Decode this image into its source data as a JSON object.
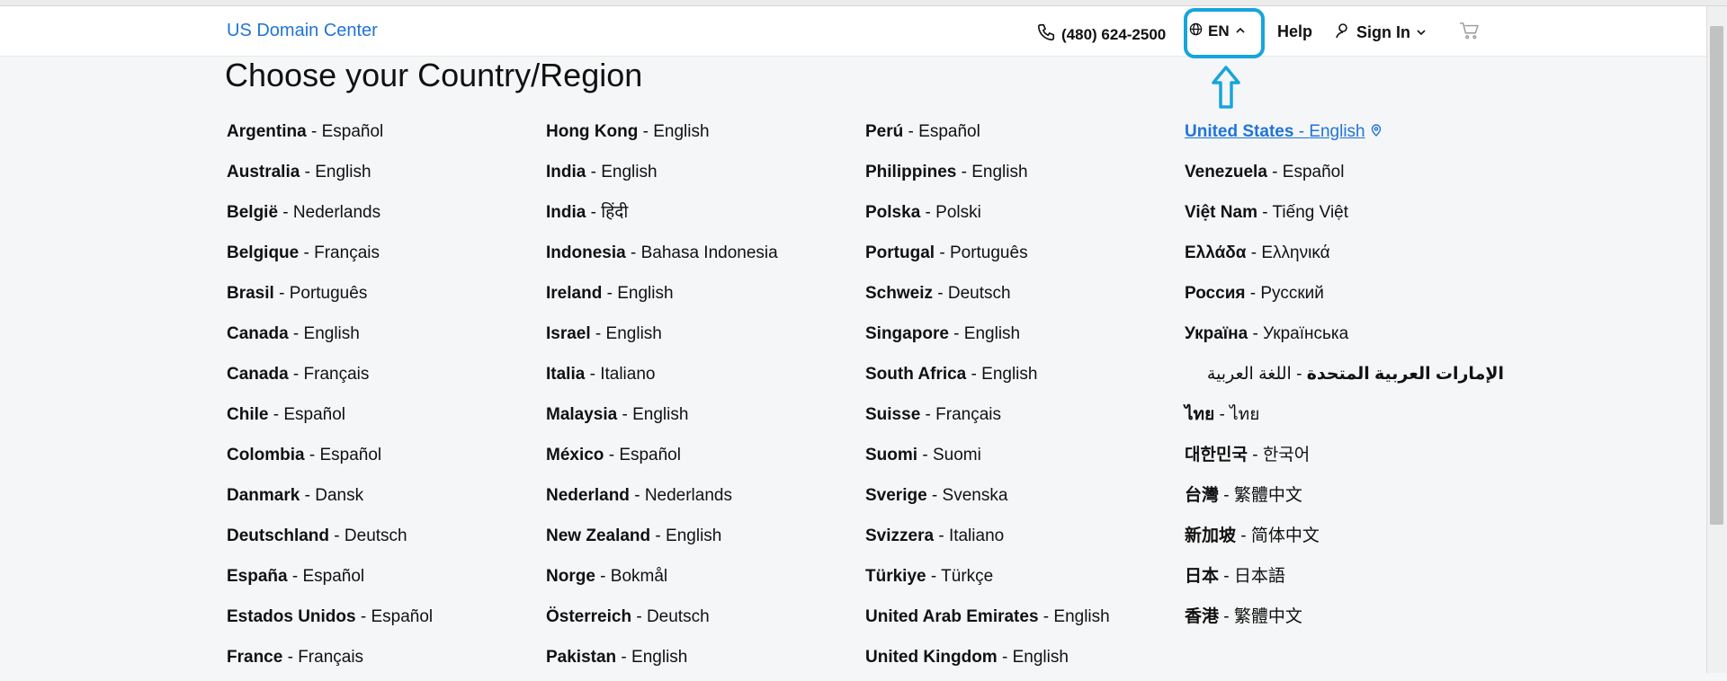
{
  "header": {
    "brand": "US Domain Center",
    "phone": "(480) 624-2500",
    "lang": "EN",
    "help": "Help",
    "signin": "Sign In"
  },
  "page": {
    "title": "Choose your Country/Region"
  },
  "countries": [
    {
      "name": "Argentina",
      "lang": "Español"
    },
    {
      "name": "Australia",
      "lang": "English"
    },
    {
      "name": "België",
      "lang": "Nederlands"
    },
    {
      "name": "Belgique",
      "lang": "Français"
    },
    {
      "name": "Brasil",
      "lang": "Português"
    },
    {
      "name": "Canada",
      "lang": "English"
    },
    {
      "name": "Canada",
      "lang": "Français"
    },
    {
      "name": "Chile",
      "lang": "Español"
    },
    {
      "name": "Colombia",
      "lang": "Español"
    },
    {
      "name": "Danmark",
      "lang": "Dansk"
    },
    {
      "name": "Deutschland",
      "lang": "Deutsch"
    },
    {
      "name": "España",
      "lang": "Español"
    },
    {
      "name": "Estados Unidos",
      "lang": "Español"
    },
    {
      "name": "France",
      "lang": "Français"
    },
    {
      "name": "Hong Kong",
      "lang": "English"
    },
    {
      "name": "India",
      "lang": "English"
    },
    {
      "name": "India",
      "lang": "हिंदी"
    },
    {
      "name": "Indonesia",
      "lang": "Bahasa Indonesia"
    },
    {
      "name": "Ireland",
      "lang": "English"
    },
    {
      "name": "Israel",
      "lang": "English"
    },
    {
      "name": "Italia",
      "lang": "Italiano"
    },
    {
      "name": "Malaysia",
      "lang": "English"
    },
    {
      "name": "México",
      "lang": "Español"
    },
    {
      "name": "Nederland",
      "lang": "Nederlands"
    },
    {
      "name": "New Zealand",
      "lang": "English"
    },
    {
      "name": "Norge",
      "lang": "Bokmål"
    },
    {
      "name": "Österreich",
      "lang": "Deutsch"
    },
    {
      "name": "Pakistan",
      "lang": "English"
    },
    {
      "name": "Perú",
      "lang": "Español"
    },
    {
      "name": "Philippines",
      "lang": "English"
    },
    {
      "name": "Polska",
      "lang": "Polski"
    },
    {
      "name": "Portugal",
      "lang": "Português"
    },
    {
      "name": "Schweiz",
      "lang": "Deutsch"
    },
    {
      "name": "Singapore",
      "lang": "English"
    },
    {
      "name": "South Africa",
      "lang": "English"
    },
    {
      "name": "Suisse",
      "lang": "Français"
    },
    {
      "name": "Suomi",
      "lang": "Suomi"
    },
    {
      "name": "Sverige",
      "lang": "Svenska"
    },
    {
      "name": "Svizzera",
      "lang": "Italiano"
    },
    {
      "name": "Türkiye",
      "lang": "Türkçe"
    },
    {
      "name": "United Arab Emirates",
      "lang": "English"
    },
    {
      "name": "United Kingdom",
      "lang": "English"
    },
    {
      "name": "United States",
      "lang": "English",
      "selected": true
    },
    {
      "name": "Venezuela",
      "lang": "Español"
    },
    {
      "name": "Việt Nam",
      "lang": "Tiếng Việt"
    },
    {
      "name": "Ελλάδα",
      "lang": "Ελληνικά"
    },
    {
      "name": "Россия",
      "lang": "Русский"
    },
    {
      "name": "Україна",
      "lang": "Українська"
    },
    {
      "name": "الإمارات العربية المتحدة",
      "lang": "اللغة العربية",
      "rtl": true
    },
    {
      "name": "ไทย",
      "lang": "ไทย"
    },
    {
      "name": "대한민국",
      "lang": "한국어"
    },
    {
      "name": "台灣",
      "lang": "繁體中文"
    },
    {
      "name": "新加坡",
      "lang": "简体中文"
    },
    {
      "name": "日本",
      "lang": "日本語"
    },
    {
      "name": "香港",
      "lang": "繁體中文"
    }
  ],
  "colors": {
    "accent": "#1f74d9",
    "highlight": "#16a5dc"
  },
  "icons": {
    "phone": "phone-icon",
    "globe": "globe-icon",
    "user": "user-icon",
    "cart": "cart-icon",
    "pin": "location-pin-icon"
  }
}
